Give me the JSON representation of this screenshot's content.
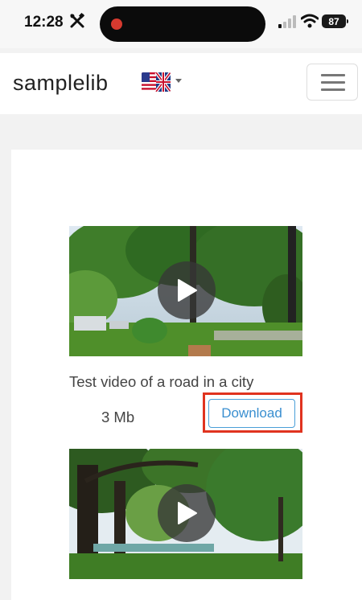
{
  "status_bar": {
    "time": "12:28",
    "battery": "87",
    "icons": [
      "tools-icon",
      "record-dot",
      "signal-icon",
      "wifi-icon",
      "battery-icon"
    ]
  },
  "navbar": {
    "brand": "samplelib",
    "language_flag": "us-uk-flag-icon",
    "menu_icon": "hamburger-icon"
  },
  "videos": [
    {
      "title": "Test video of a road in a city",
      "size": "3 Mb",
      "download_label": "Download",
      "highlighted": true
    },
    {
      "title": "",
      "size": "",
      "download_label": ""
    }
  ],
  "colors": {
    "accent_link": "#3a8fd0",
    "highlight_box": "#e0331f",
    "page_bg": "#f2f2f2"
  }
}
